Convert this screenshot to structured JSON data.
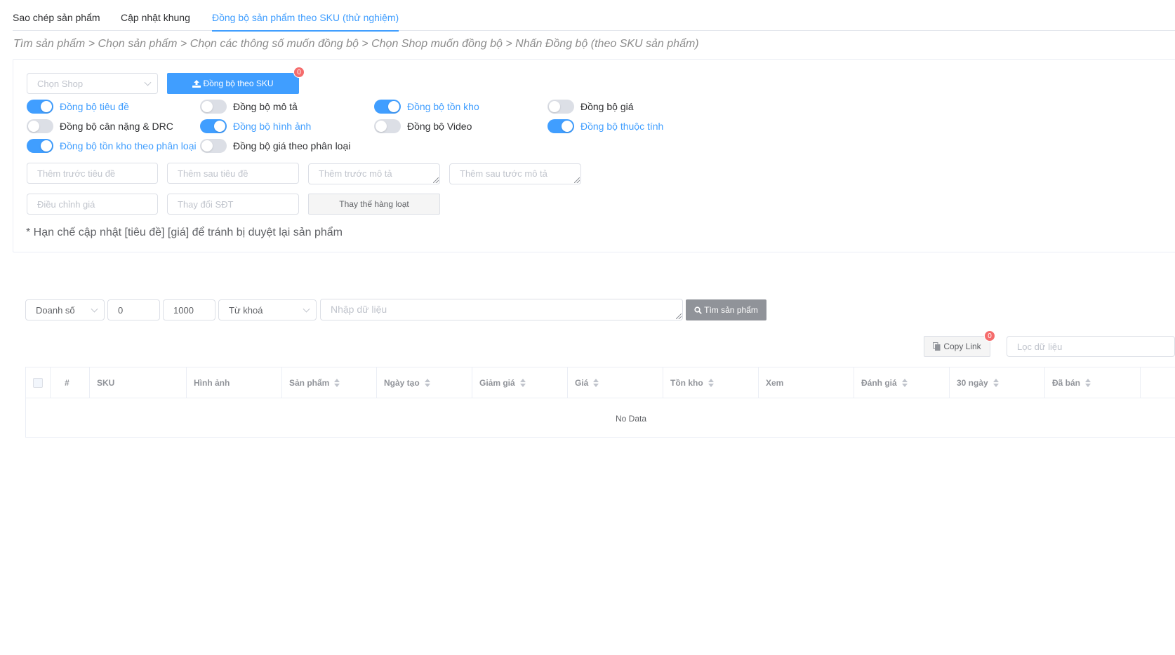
{
  "tabs": [
    {
      "label": "Sao chép sản phẩm",
      "active": false
    },
    {
      "label": "Cập nhật khung",
      "active": false
    },
    {
      "label": "Đồng bộ sản phẩm theo SKU (thử nghiệm)",
      "active": true
    }
  ],
  "breadcrumb": "Tìm sản phẩm > Chọn sản phẩm > Chọn các thông số muốn đồng bộ > Chọn Shop muốn đồng bộ > Nhấn Đồng bộ (theo SKU sản phẩm)",
  "shop_select": {
    "placeholder": "Chọn Shop"
  },
  "sync_button": {
    "label": "Đồng bộ theo SKU",
    "badge": "0",
    "icon": "upload-icon"
  },
  "toggles": [
    {
      "label": "Đồng bộ tiêu đề",
      "on": true
    },
    {
      "label": "Đồng bộ mô tả",
      "on": false
    },
    {
      "label": "Đồng bộ tồn kho",
      "on": true
    },
    {
      "label": "Đồng bộ giá",
      "on": false
    },
    {
      "label": "Đồng bộ cân nặng & DRC",
      "on": false
    },
    {
      "label": "Đồng bộ hình ảnh",
      "on": true
    },
    {
      "label": "Đồng bộ Video",
      "on": false
    },
    {
      "label": "Đồng bộ thuộc tính",
      "on": true
    },
    {
      "label": "Đồng bộ tồn kho theo phân loại",
      "on": true
    },
    {
      "label": "Đồng bộ giá theo phân loại",
      "on": false
    }
  ],
  "fields": {
    "before_title": "Thêm trước tiêu đề",
    "after_title": "Thêm sau tiêu đề",
    "before_desc": "Thêm trước mô tả",
    "after_desc": "Thêm sau tước mô tả",
    "adjust_price": "Điều chỉnh giá",
    "change_phone": "Thay đổi SĐT"
  },
  "bulk_replace_button": "Thay thế hàng loạt",
  "note": "* Hạn chế cập nhật [tiêu đề] [giá] để tránh bị duyệt lại sản phẩm",
  "filter": {
    "metric": "Doanh số",
    "min": "0",
    "max": "1000",
    "type": "Từ khoá",
    "query_placeholder": "Nhập dữ liệu",
    "search_button": "Tìm sản phẩm"
  },
  "copy_link": {
    "label": "Copy Link",
    "badge": "0",
    "icon": "copy-icon"
  },
  "filter_data_placeholder": "Lọc dữ liệu",
  "table": {
    "columns": [
      {
        "label": "",
        "sortable": false
      },
      {
        "label": "#",
        "sortable": false
      },
      {
        "label": "SKU",
        "sortable": false
      },
      {
        "label": "Hình ảnh",
        "sortable": false
      },
      {
        "label": "Sản phẩm",
        "sortable": true
      },
      {
        "label": "Ngày tạo",
        "sortable": true
      },
      {
        "label": "Giảm giá",
        "sortable": true
      },
      {
        "label": "Giá",
        "sortable": true
      },
      {
        "label": "Tồn kho",
        "sortable": true
      },
      {
        "label": "Xem",
        "sortable": false
      },
      {
        "label": "Đánh giá",
        "sortable": true
      },
      {
        "label": "30 ngày",
        "sortable": true
      },
      {
        "label": "Đã bán",
        "sortable": true
      }
    ],
    "empty_text": "No Data"
  },
  "colors": {
    "accent": "#409eff",
    "badge": "#f56c6c",
    "search_button": "#909399"
  }
}
